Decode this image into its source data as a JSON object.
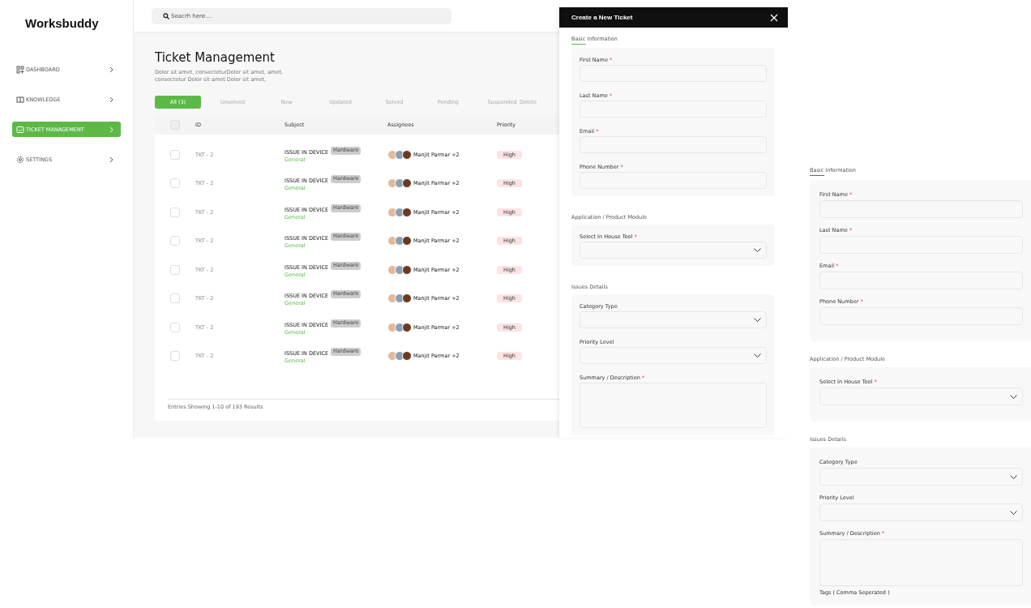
{
  "dashboard": {
    "logo": "Worksbuddy",
    "search": {
      "placeholder": "Seacrh here...."
    },
    "sidebar": {
      "items": [
        {
          "label": "DASHBOARD",
          "selected": false
        },
        {
          "label": "KNOWLEDGE",
          "selected": false
        },
        {
          "label": "TICKET MANAGEMENT",
          "selected": true
        },
        {
          "label": "SETTINGS",
          "selected": false
        }
      ]
    },
    "title": "Ticket Management",
    "description": "Dolor sit amet, consecteturDolor sit amet, amet, consectetur Dolor sit amet Dolor sit amet,",
    "tabs": [
      {
        "label": "All (3)",
        "selected": true
      },
      {
        "label": "Unsolved",
        "selected": false
      },
      {
        "label": "New",
        "selected": false
      },
      {
        "label": "Updated",
        "selected": false
      },
      {
        "label": "Solved",
        "selected": false
      },
      {
        "label": "Pending",
        "selected": false
      },
      {
        "label": "Suspended",
        "selected": false
      },
      {
        "label": "Delete",
        "selected": false
      }
    ],
    "table": {
      "all_checked": false,
      "columns": [
        "ID",
        "Subject",
        "Assignees",
        "Priority"
      ],
      "rows": [
        {
          "checked": false,
          "id": "TKT - 2",
          "subject": "ISSUE IN DEVICE",
          "tag": "Hardware",
          "category": "General",
          "assignee": "Manjit Parmar +2",
          "priority": "High"
        },
        {
          "checked": false,
          "id": "TKT - 2",
          "subject": "ISSUE IN DEVICE",
          "tag": "Hardware",
          "category": "General",
          "assignee": "Manjit Parmar +2",
          "priority": "High"
        },
        {
          "checked": false,
          "id": "TKT - 2",
          "subject": "ISSUE IN DEVICE",
          "tag": "Hardware",
          "category": "General",
          "assignee": "Manjit Parmar +2",
          "priority": "High"
        },
        {
          "checked": false,
          "id": "TKT - 2",
          "subject": "ISSUE IN DEVICE",
          "tag": "Hardware",
          "category": "General",
          "assignee": "Manjit Parmar +2",
          "priority": "High"
        },
        {
          "checked": false,
          "id": "TKT - 2",
          "subject": "ISSUE IN DEVICE",
          "tag": "Hardware",
          "category": "General",
          "assignee": "Manjit Parmar +2",
          "priority": "High"
        },
        {
          "checked": false,
          "id": "TKT - 2",
          "subject": "ISSUE IN DEVICE",
          "tag": "Hardware",
          "category": "General",
          "assignee": "Manjit Parmar +2",
          "priority": "High"
        },
        {
          "checked": false,
          "id": "TKT - 2",
          "subject": "ISSUE IN DEVICE",
          "tag": "Hardware",
          "category": "General",
          "assignee": "Manjit Parmar +2",
          "priority": "High"
        },
        {
          "checked": false,
          "id": "TKT - 2",
          "subject": "ISSUE IN DEVICE",
          "tag": "Hardware",
          "category": "General",
          "assignee": "Manjit Parmar +2",
          "priority": "High"
        }
      ],
      "footer": "Entries Showing 1-10 of 193 Results"
    }
  },
  "forms": [
    {
      "title": "Create a New Ticket",
      "color": "#5cb947",
      "sections": [
        {
          "heading": "Basic Information",
          "fields": [
            {
              "label": "First Name",
              "mark": "*",
              "kind": "text"
            },
            {
              "label": "Last Name",
              "mark": "*",
              "kind": "text"
            },
            {
              "label": "Email",
              "mark": "*",
              "kind": "text"
            },
            {
              "label": "Phone Number",
              "mark": "*",
              "kind": "text"
            }
          ]
        },
        {
          "heading": "Application / Product Module",
          "fields": [
            {
              "label": "Select In House Tool",
              "mark": "*",
              "kind": "select"
            }
          ]
        },
        {
          "heading": "Issues Details",
          "fields": [
            {
              "label": "Category Type",
              "kind": "select"
            },
            {
              "label": "Priority Level",
              "kind": "select"
            },
            {
              "label": "Summary / Description",
              "mark": "*",
              "kind": "textarea"
            }
          ]
        }
      ]
    },
    {
      "color": "#6c4de6",
      "sections": [
        {
          "heading": "Basic Information",
          "fields": [
            {
              "label": "First Name",
              "mark": "*",
              "kind": "text"
            },
            {
              "label": "Last Name",
              "mark": "*",
              "kind": "text"
            },
            {
              "label": "Email",
              "mark": "*",
              "kind": "text"
            },
            {
              "label": "Phone Number",
              "mark": "*",
              "kind": "text"
            }
          ]
        },
        {
          "heading": "Application / Product Module",
          "fields": [
            {
              "label": "Select In House Tool",
              "mark": "*",
              "kind": "select"
            }
          ]
        },
        {
          "heading": "Issues Details",
          "fields": [
            {
              "label": "Category Type",
              "kind": "select"
            },
            {
              "label": "Priority Level",
              "kind": "select"
            },
            {
              "label": "Summary / Description",
              "mark": "*",
              "kind": "textarea"
            },
            {
              "label": "Tags ( Comma Seperated )",
              "kind": "label"
            }
          ]
        }
      ]
    }
  ]
}
